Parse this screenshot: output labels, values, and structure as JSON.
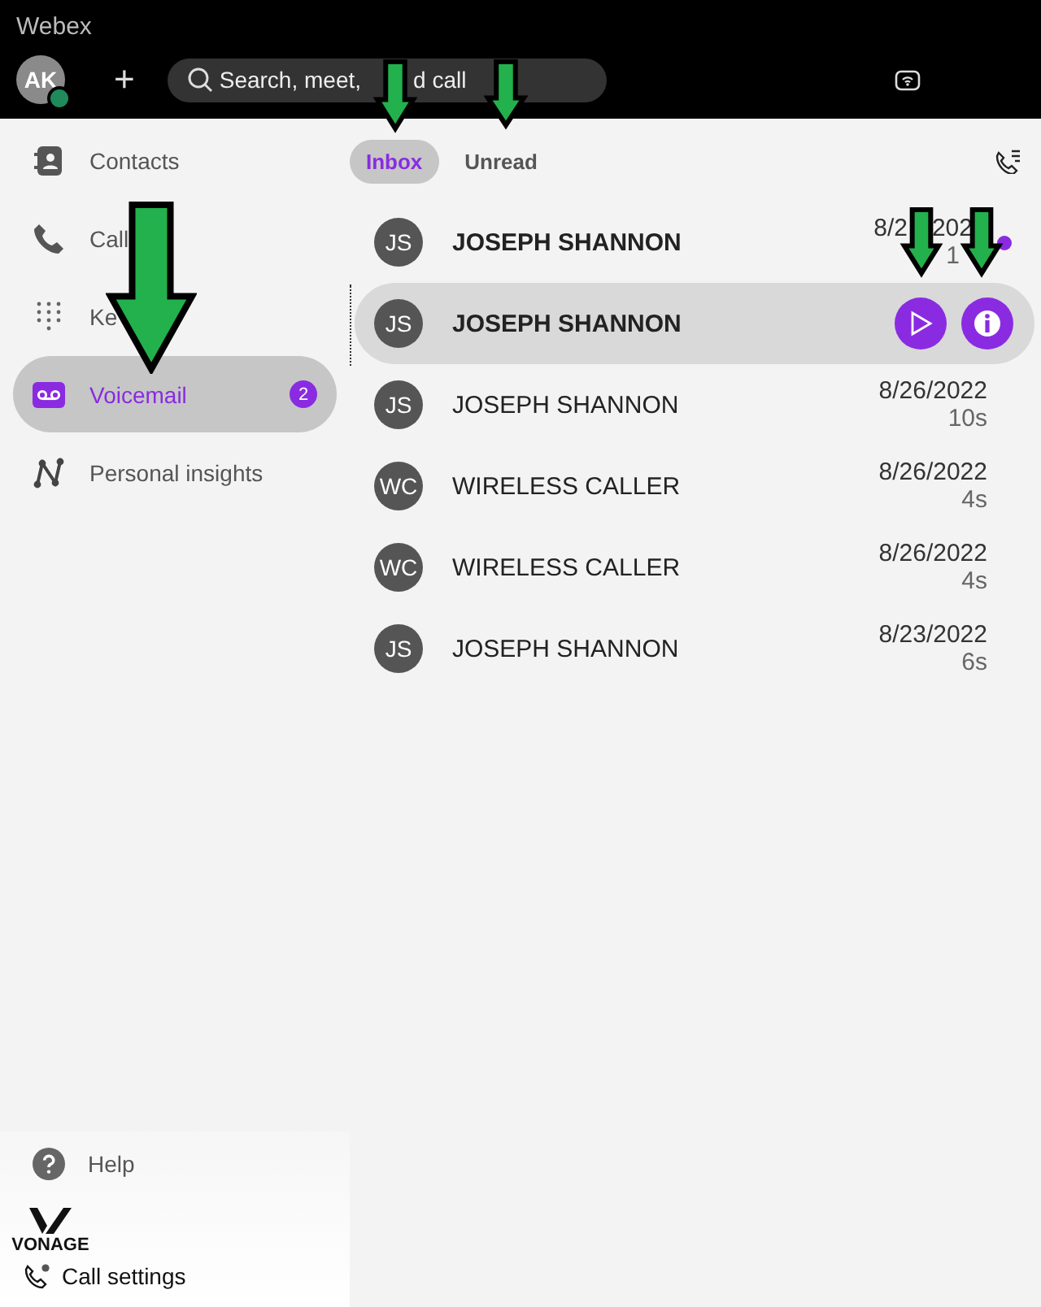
{
  "window": {
    "title": "Webex"
  },
  "header": {
    "avatar": "AK",
    "new_button": "+",
    "search": {
      "placeholder_parts": [
        "Search, meet,",
        "d call"
      ]
    }
  },
  "sidebar": {
    "items": [
      {
        "label": "Contacts",
        "selected": false
      },
      {
        "label": "Call",
        "selected": false
      },
      {
        "label": "Ke",
        "selected": false
      },
      {
        "label": "Voicemail",
        "selected": true,
        "badge": "2"
      },
      {
        "label": "Personal insights",
        "selected": false
      }
    ],
    "help": "Help",
    "logo_text": "VONAGE",
    "call_settings": "Call settings"
  },
  "tabs": [
    {
      "label": "Inbox",
      "selected": true
    },
    {
      "label": "Unread",
      "selected": false
    }
  ],
  "voicemails": [
    {
      "initials": "JS",
      "name": "JOSEPH SHANNON",
      "unread": true,
      "hovered": false,
      "date_parts": [
        "8/2",
        "202"
      ],
      "duration": "1"
    },
    {
      "initials": "JS",
      "name": "JOSEPH SHANNON",
      "unread": true,
      "hovered": true
    },
    {
      "initials": "JS",
      "name": "JOSEPH SHANNON",
      "unread": false,
      "hovered": false,
      "date_parts": [
        "8/26/2022"
      ],
      "duration": "10s"
    },
    {
      "initials": "WC",
      "name": "WIRELESS CALLER",
      "unread": false,
      "hovered": false,
      "date_parts": [
        "8/26/2022"
      ],
      "duration": "4s"
    },
    {
      "initials": "WC",
      "name": "WIRELESS CALLER",
      "unread": false,
      "hovered": false,
      "date_parts": [
        "8/26/2022"
      ],
      "duration": "4s"
    },
    {
      "initials": "JS",
      "name": "JOSEPH SHANNON",
      "unread": false,
      "hovered": false,
      "date_parts": [
        "8/23/2022"
      ],
      "duration": "6s"
    }
  ]
}
